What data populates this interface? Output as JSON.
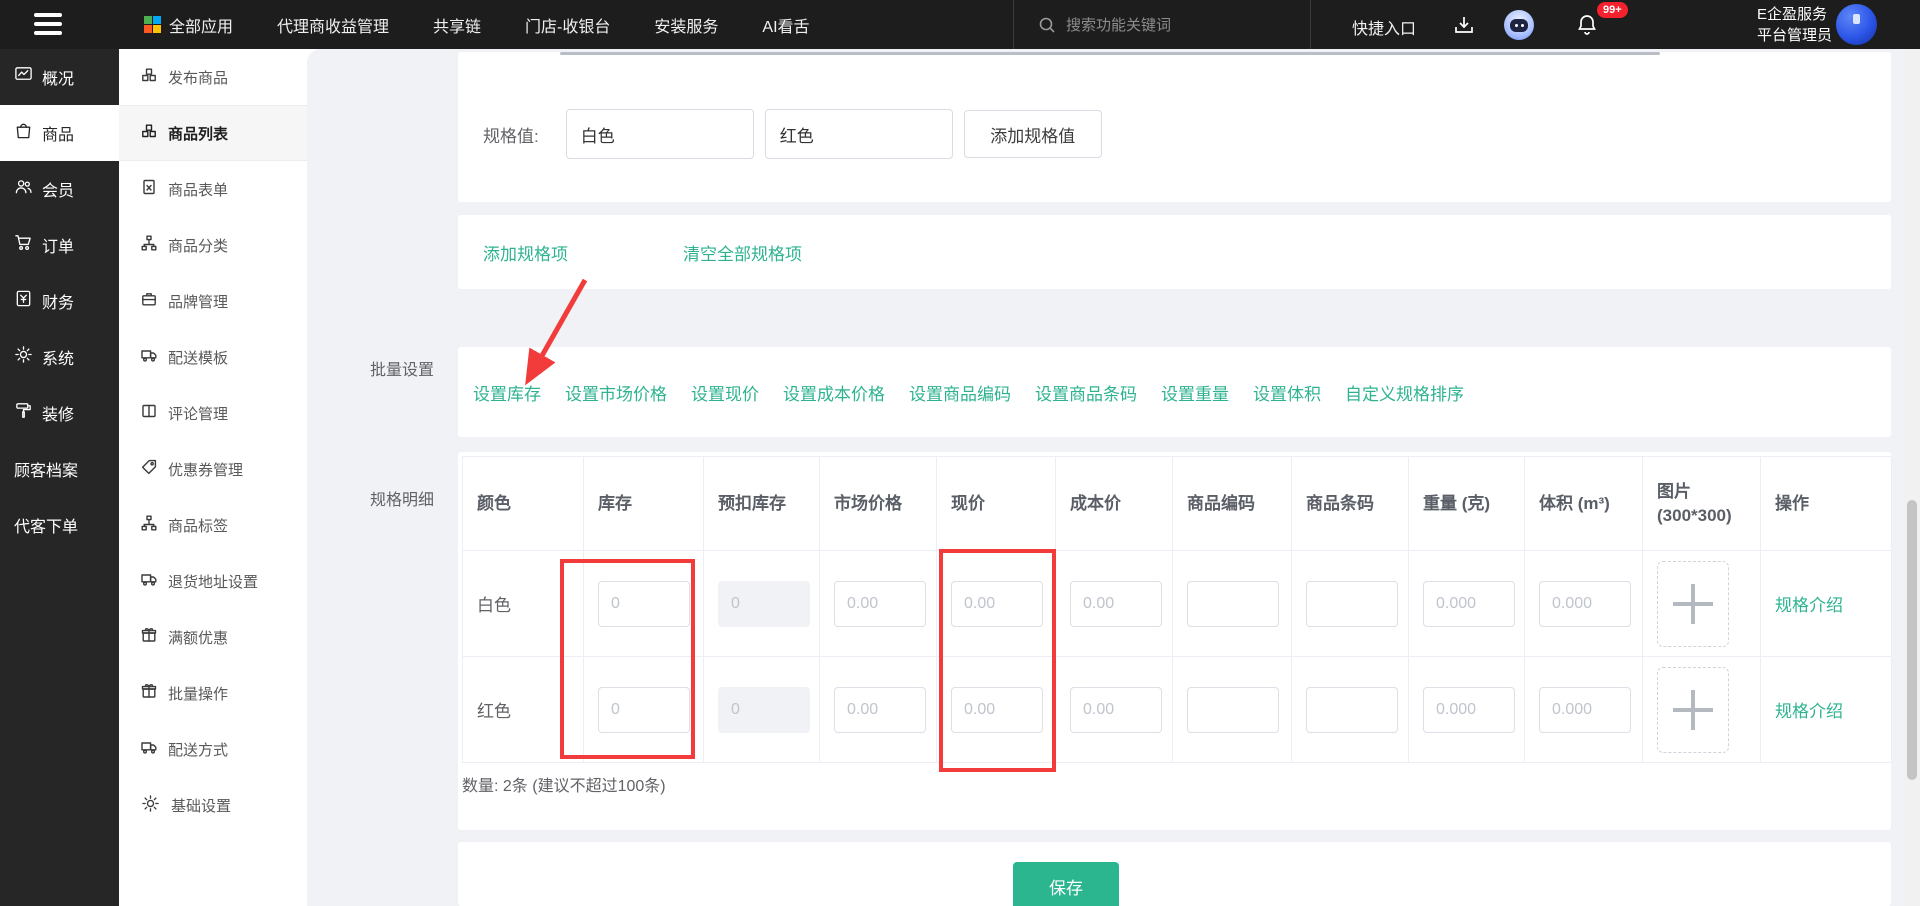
{
  "navbar": {
    "menu": [
      "全部应用",
      "代理商收益管理",
      "共享链",
      "门店-收银台",
      "安装服务",
      "AI看舌"
    ],
    "search_placeholder": "搜索功能关键词",
    "quick_entry": "快捷入口",
    "notification_badge": "99+",
    "user_line1": "E企盈服务",
    "user_line2": "平台管理员",
    "icons": [
      "hamburger-icon",
      "apps-grid-icon",
      "search-icon",
      "download-icon",
      "robot-assistant-icon",
      "bell-icon",
      "avatar"
    ]
  },
  "sidebar": {
    "items": [
      {
        "label": "概况",
        "icon": "chart"
      },
      {
        "label": "商品",
        "icon": "bag",
        "active": true
      },
      {
        "label": "会员",
        "icon": "users"
      },
      {
        "label": "订单",
        "icon": "cart"
      },
      {
        "label": "财务",
        "icon": "finance"
      },
      {
        "label": "系统",
        "icon": "gear"
      },
      {
        "label": "装修",
        "icon": "roller"
      },
      {
        "label": "顾客档案",
        "icon": null
      },
      {
        "label": "代客下单",
        "icon": null
      }
    ]
  },
  "submenu": {
    "items": [
      {
        "label": "发布商品",
        "icon": "cubes"
      },
      {
        "label": "商品列表",
        "icon": "cubes",
        "active": true
      },
      {
        "label": "商品表单",
        "icon": "doc"
      },
      {
        "label": "商品分类",
        "icon": "sitemap"
      },
      {
        "label": "品牌管理",
        "icon": "briefcase"
      },
      {
        "label": "配送模板",
        "icon": "truck"
      },
      {
        "label": "评论管理",
        "icon": "columns"
      },
      {
        "label": "优惠券管理",
        "icon": "tag"
      },
      {
        "label": "商品标签",
        "icon": "sitemap"
      },
      {
        "label": "退货地址设置",
        "icon": "truck"
      },
      {
        "label": "满额优惠",
        "icon": "gift"
      },
      {
        "label": "批量操作",
        "icon": "gift"
      },
      {
        "label": "配送方式",
        "icon": "truck"
      },
      {
        "label": "基础设置",
        "icon": "gear"
      }
    ]
  },
  "main": {
    "spec_value_label": "规格值:",
    "spec_values": [
      "白色",
      "红色"
    ],
    "add_spec_value_btn": "添加规格值",
    "add_spec_item_link": "添加规格项",
    "clear_spec_items_link": "清空全部规格项",
    "batch_label": "批量设置",
    "batch_links": [
      "设置库存",
      "设置市场价格",
      "设置现价",
      "设置成本价格",
      "设置商品编码",
      "设置商品条码",
      "设置重量",
      "设置体积",
      "自定义规格排序"
    ],
    "detail_label": "规格明细",
    "table": {
      "headers": [
        "颜色",
        "库存",
        "预扣库存",
        "市场价格",
        "现价",
        "成本价",
        "商品编码",
        "商品条码",
        "重量 (克)",
        "体积 (m³)",
        "图片 (300*300)",
        "操作"
      ],
      "placeholders": {
        "stock": "0",
        "hold": "0",
        "market": "0.00",
        "price": "0.00",
        "cost": "0.00",
        "code": "",
        "barcode": "",
        "weight": "0.000",
        "volume": "0.000"
      },
      "rows": [
        {
          "name": "白色"
        },
        {
          "name": "红色"
        }
      ],
      "op_link": "规格介绍",
      "upload_icon": "plus-upload-icon"
    },
    "count_note": "数量: 2条 (建议不超过100条)",
    "save_label": "保存"
  },
  "colors": {
    "accent_link": "#2eb390",
    "save_button": "#2cb690",
    "annotation_red": "#f23c3c",
    "navbar_bg": "#1d1d1d",
    "sidebar_bg": "#262626",
    "badge_red": "#f5222d"
  }
}
